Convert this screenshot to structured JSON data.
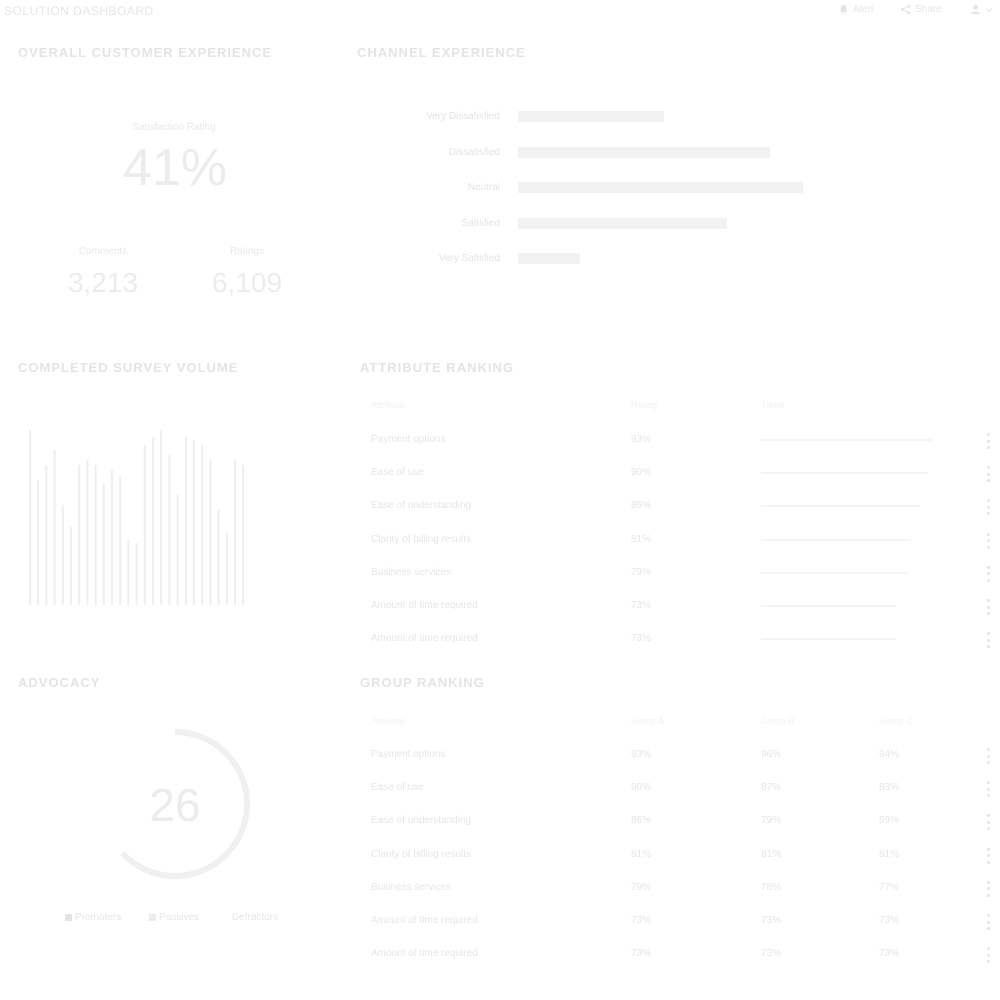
{
  "header": {
    "app_title": "SOLUTION DASHBOARD",
    "actions": [
      {
        "label": "Alert",
        "icon": "bell-icon"
      },
      {
        "label": "Share",
        "icon": "share-icon"
      },
      {
        "label": "",
        "icon": "user-icon"
      }
    ]
  },
  "overall": {
    "title": "OVERALL CUSTOMER EXPERIENCE",
    "satisfaction_label": "Satisfaction Rating",
    "satisfaction_value": "41%",
    "comments_label": "Comments",
    "comments_value": "3,213",
    "ratings_label": "Ratings",
    "ratings_value": "6,109"
  },
  "channel": {
    "title": "CHANNEL EXPERIENCE",
    "rows": [
      {
        "label": "Very Dissatisfied",
        "value": 0.22
      },
      {
        "label": "Dissatisfied",
        "value": 0.38
      },
      {
        "label": "Neutral",
        "value": 0.43
      },
      {
        "label": "Satisfied",
        "value": 0.315
      },
      {
        "label": "Very Satisfied",
        "value": 0.093
      }
    ]
  },
  "survey": {
    "title": "COMPLETED SURVEY VOLUME"
  },
  "chart_data": {
    "type": "bar",
    "title": "COMPLETED SURVEY VOLUME",
    "values": [
      175,
      125,
      140,
      155,
      100,
      78,
      140,
      145,
      140,
      122,
      135,
      128,
      65,
      62,
      160,
      168,
      175,
      150,
      110,
      168,
      165,
      160,
      145,
      95,
      72,
      145,
      140
    ],
    "ylim": [
      0,
      180
    ]
  },
  "attribute": {
    "title": "ATTRIBUTE RANKING",
    "headers": [
      "Attribute",
      "Rating",
      "Trend"
    ],
    "rows": [
      {
        "name": "Payment options",
        "rating": "93%",
        "value": 0.93
      },
      {
        "name": "Ease of use",
        "rating": "90%",
        "value": 0.9
      },
      {
        "name": "Ease of understanding",
        "rating": "86%",
        "value": 0.86
      },
      {
        "name": "Clarity of billing results",
        "rating": "81%",
        "value": 0.81
      },
      {
        "name": "Business services",
        "rating": "79%",
        "value": 0.79
      },
      {
        "name": "Amount of time required",
        "rating": "73%",
        "value": 0.73
      },
      {
        "name": "Amount of time required",
        "rating": "73%",
        "value": 0.73
      }
    ]
  },
  "advocacy": {
    "title": "ADVOCACY",
    "score": "26",
    "score_fraction": 0.63,
    "legend": [
      {
        "label": "Promoters"
      },
      {
        "label": "Passives"
      },
      {
        "label": "Detractors"
      }
    ]
  },
  "group": {
    "title": "GROUP RANKING",
    "headers": [
      "Attribute",
      "Group A",
      "Group B",
      "Group C"
    ],
    "rows": [
      {
        "name": "Payment options",
        "a": "93%",
        "b": "96%",
        "c": "94%"
      },
      {
        "name": "Ease of use",
        "a": "90%",
        "b": "87%",
        "c": "83%"
      },
      {
        "name": "Ease of understanding",
        "a": "86%",
        "b": "79%",
        "c": "89%"
      },
      {
        "name": "Clarity of billing results",
        "a": "81%",
        "b": "81%",
        "c": "81%"
      },
      {
        "name": "Business services",
        "a": "79%",
        "b": "78%",
        "c": "77%"
      },
      {
        "name": "Amount of time required",
        "a": "73%",
        "b": "73%",
        "c": "73%"
      },
      {
        "name": "Amount of time required",
        "a": "73%",
        "b": "73%",
        "c": "73%"
      }
    ]
  },
  "colors": {
    "text": "#e6e6e6",
    "bar": "#f2f2f2",
    "accent": "#eeeeee"
  }
}
